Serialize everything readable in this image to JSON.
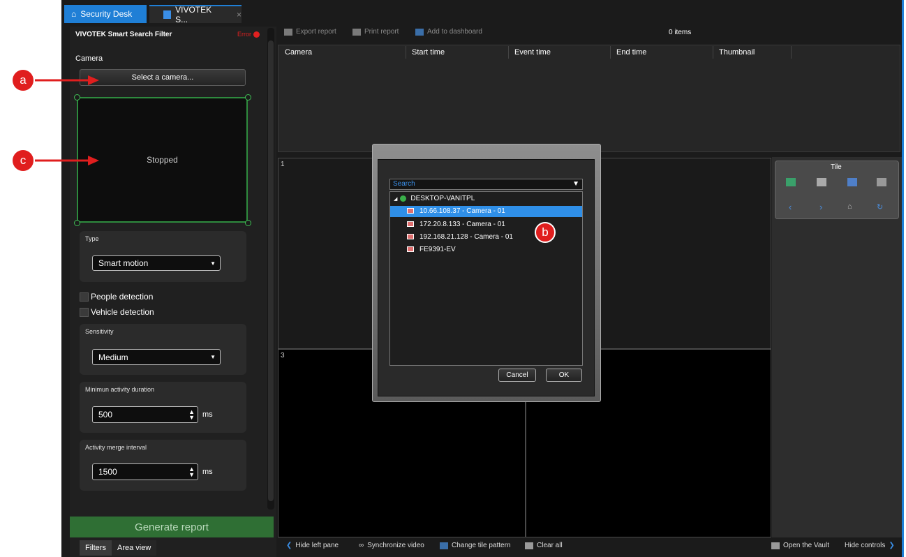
{
  "tabs": {
    "home": "Security Desk",
    "active": "VIVOTEK S...",
    "close": "×"
  },
  "filter_pane": {
    "title": "VIVOTEK Smart Search Filter",
    "error": "Error",
    "camera_label": "Camera",
    "select_camera": "Select a camera...",
    "preview_status": "Stopped",
    "type_label": "Type",
    "type_value": "Smart motion",
    "people_detection": "People detection",
    "vehicle_detection": "Vehicle detection",
    "sensitivity_label": "Sensitivity",
    "sensitivity_value": "Medium",
    "min_duration_label": "Minimun activity duration",
    "min_duration_value": "500",
    "merge_label": "Activity merge interval",
    "merge_value": "1500",
    "unit_ms": "ms",
    "generate": "Generate report",
    "bottom_tabs": [
      "Filters",
      "Area view"
    ]
  },
  "toolbar": {
    "export": "Export report",
    "print": "Print report",
    "dashboard": "Add to dashboard",
    "count": "0 items"
  },
  "columns": [
    "Camera",
    "Start time",
    "Event time",
    "End time",
    "Thumbnail"
  ],
  "tiles": {
    "t1": "1",
    "t3": "3"
  },
  "tile_panel": {
    "title": "Tile"
  },
  "dialog": {
    "search_placeholder": "Search",
    "root": "DESKTOP-VANITPL",
    "items": [
      "10.66.108.37 - Camera - 01",
      "172.20.8.133 - Camera - 01",
      "192.168.21.128 - Camera - 01",
      "FE9391-EV"
    ],
    "cancel": "Cancel",
    "ok": "OK"
  },
  "bottom_bar": {
    "hide_left": "Hide left pane",
    "sync": "Synchronize video",
    "tile_pattern": "Change tile pattern",
    "clear_all": "Clear all",
    "vault": "Open the Vault",
    "hide_controls": "Hide controls"
  },
  "callouts": {
    "a": "a",
    "b": "b",
    "c": "c"
  },
  "colors": {
    "accent": "#1f7fd6",
    "callout": "#e01e1e",
    "selection": "#2f8fe8",
    "generate": "#2f6f34"
  }
}
